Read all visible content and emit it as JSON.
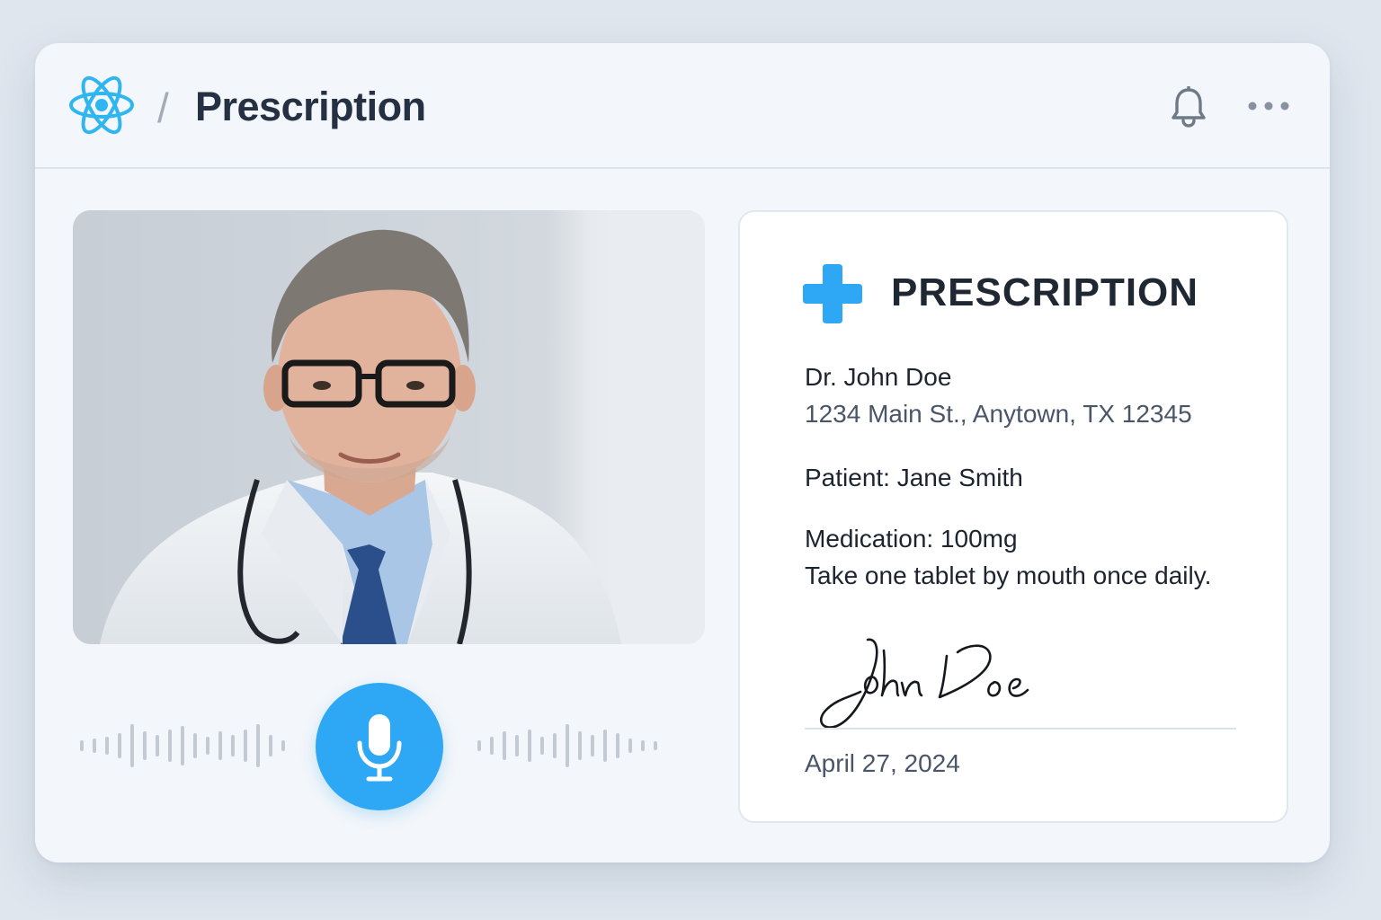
{
  "header": {
    "breadcrumb_separator": "/",
    "title": "Prescription",
    "logo_icon": "atom-logo-icon",
    "actions": [
      "bell-icon",
      "more-icon"
    ]
  },
  "video": {
    "subject": "doctor-video-feed"
  },
  "controls": {
    "mic_icon": "microphone-icon",
    "accent_color": "#2ea8f5"
  },
  "prescription": {
    "heading": "PRESCRIPTION",
    "heading_icon": "medical-cross-icon",
    "doctor_name": "Dr. John Doe",
    "doctor_address": "1234 Main St., Anytown, TX 12345",
    "patient": "Patient: Jane Smith",
    "medication": "Medication: 100mg",
    "instructions": "Take one tablet by mouth once daily.",
    "signature": "John Doe",
    "date": "April 27, 2024"
  }
}
